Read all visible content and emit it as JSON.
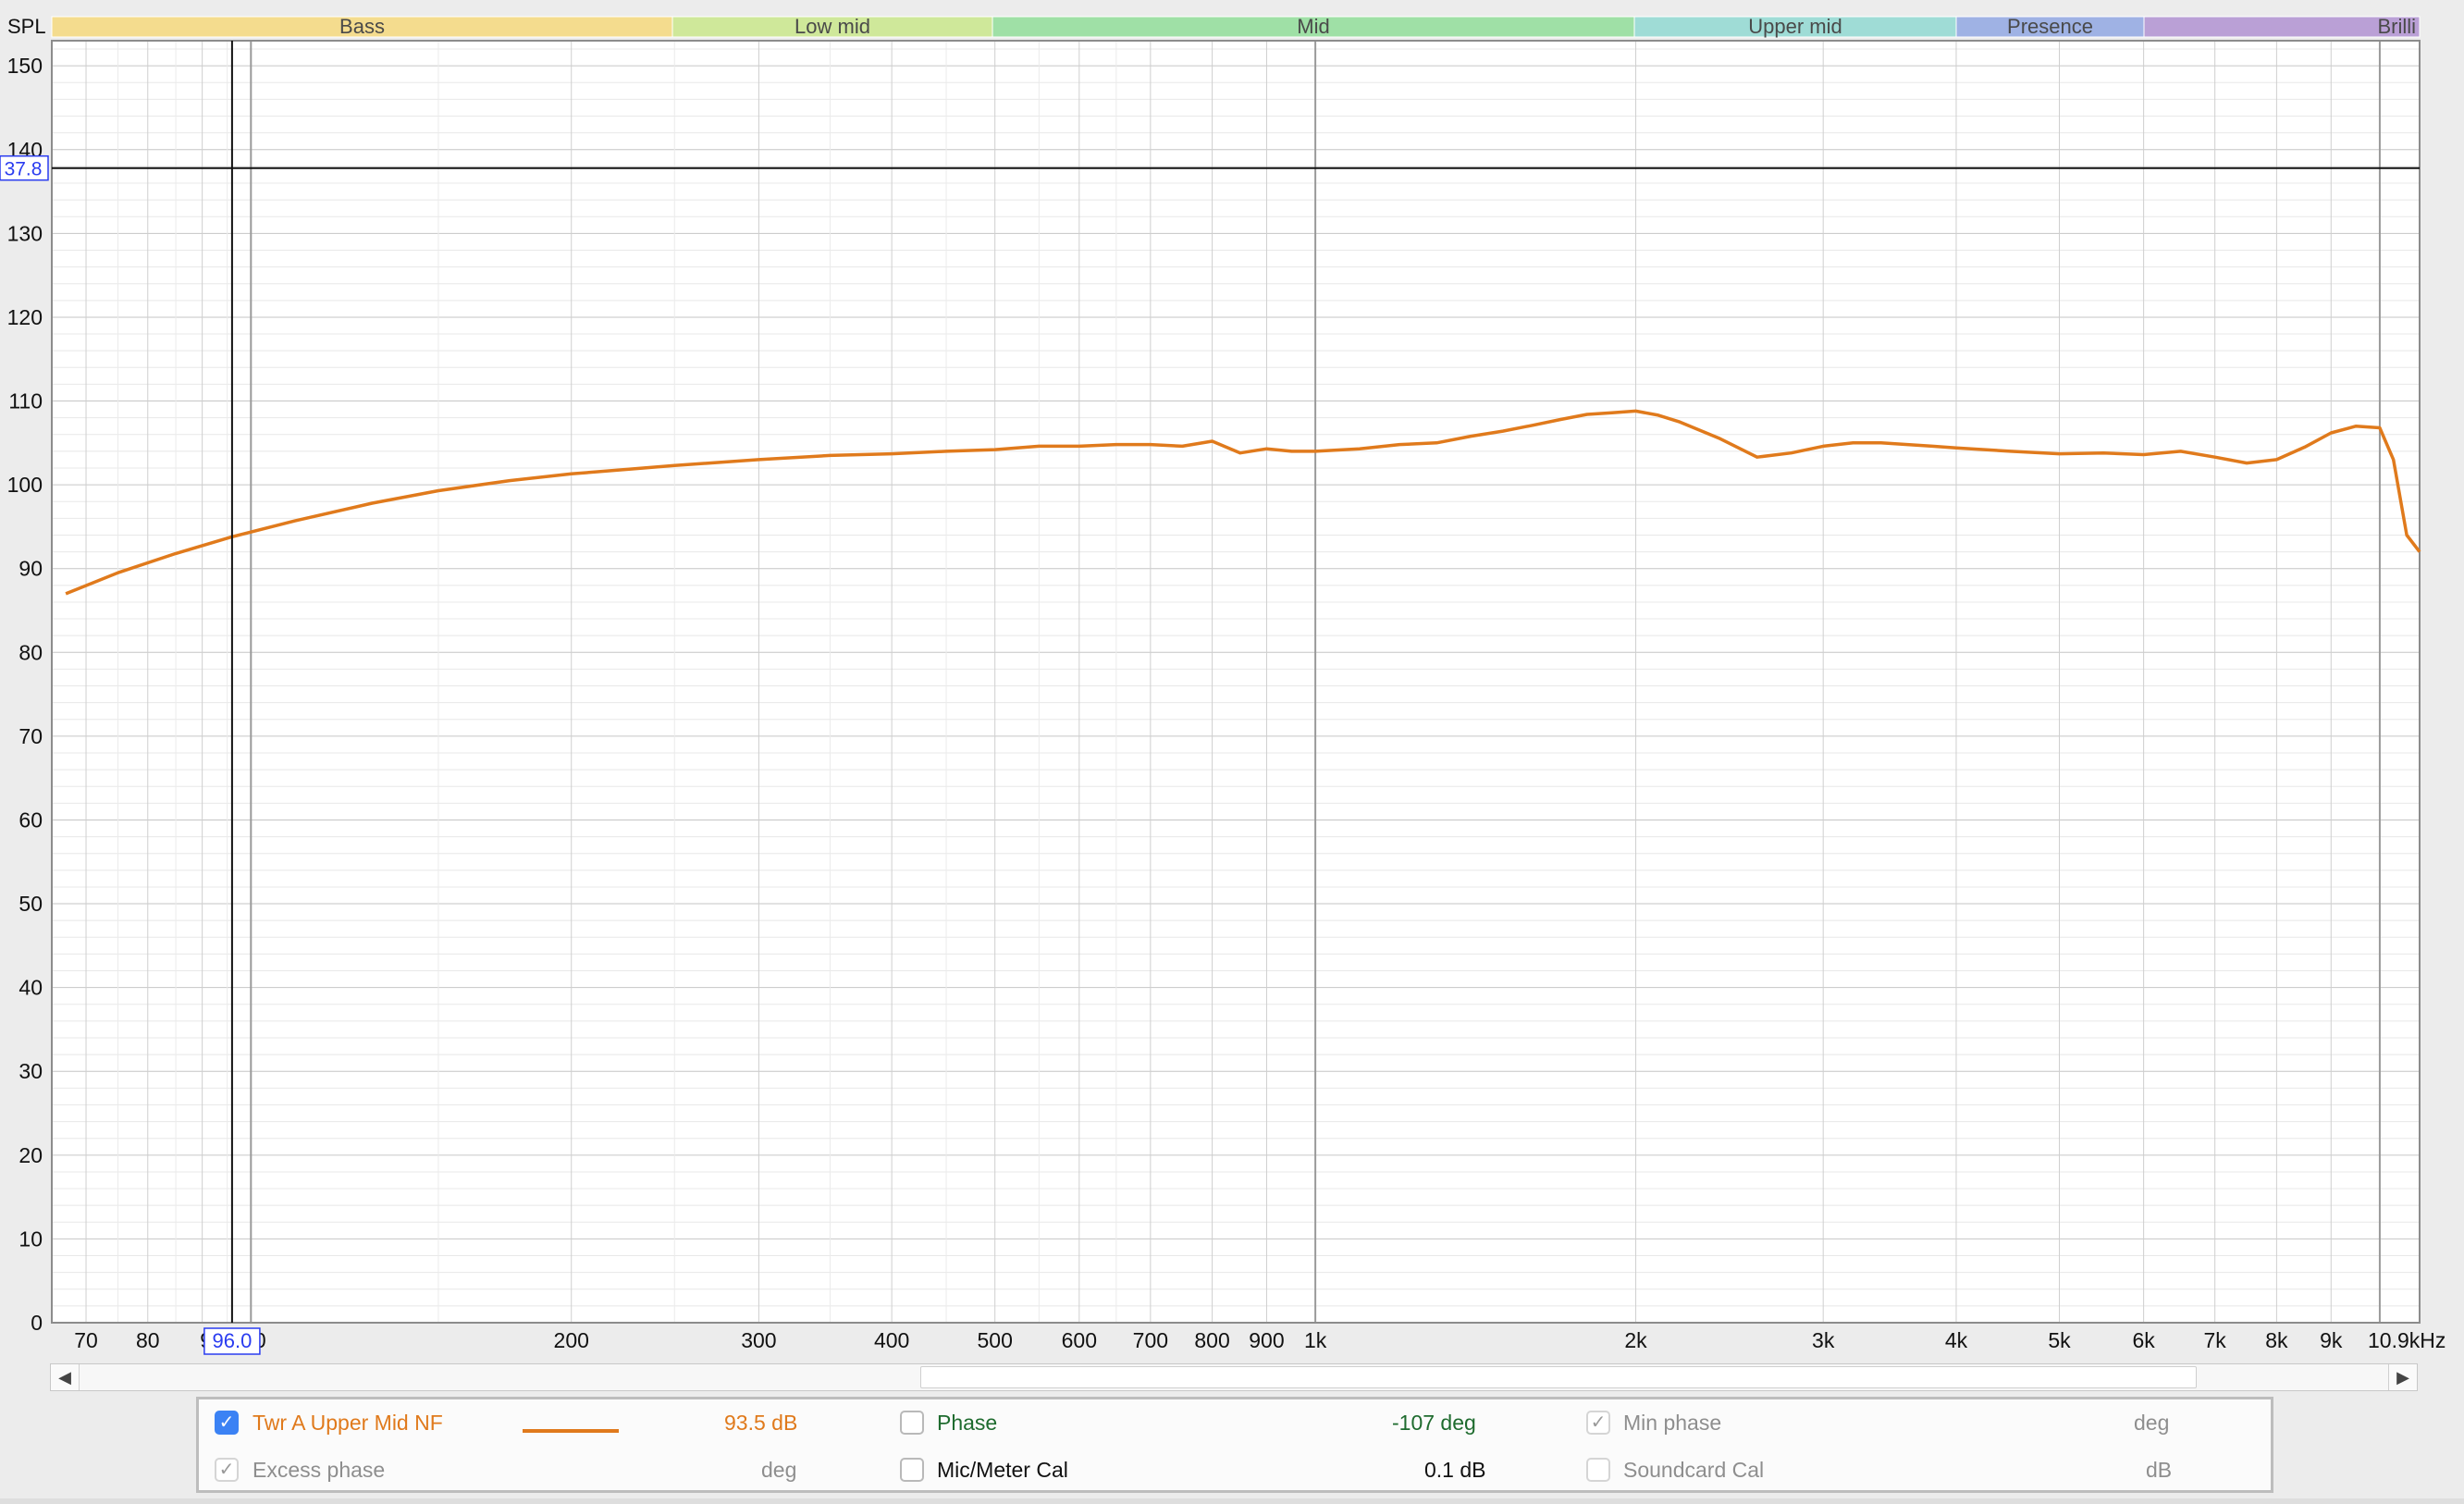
{
  "bands": [
    {
      "label": "Bass",
      "color": "#f4dc8e"
    },
    {
      "label": "Low mid",
      "color": "#cfe89a"
    },
    {
      "label": "Mid",
      "color": "#9fe0a6"
    },
    {
      "label": "Upper mid",
      "color": "#9fdcd6"
    },
    {
      "label": "Presence",
      "color": "#9fb2e4"
    },
    {
      "label": "Brilli",
      "color": "#baa0d6"
    }
  ],
  "y_axis_title": "SPL",
  "y_ticks": [
    "150",
    "140",
    "130",
    "120",
    "110",
    "100",
    "90",
    "80",
    "70",
    "60",
    "50",
    "40",
    "30",
    "20",
    "10",
    "0"
  ],
  "x_ticks": [
    "70",
    "80",
    "9",
    "0",
    "200",
    "300",
    "400",
    "500",
    "600",
    "700",
    "800",
    "900",
    "1k",
    "2k",
    "3k",
    "4k",
    "5k",
    "6k",
    "7k",
    "8k",
    "9k",
    "10.9kHz"
  ],
  "cursor": {
    "y_readout": "37.8",
    "x_readout": "96.0"
  },
  "chart_data": {
    "type": "line",
    "xscale": "log",
    "xlim": [
      65,
      10900
    ],
    "ylim": [
      0,
      153
    ],
    "grid": true,
    "ylabel": "SPL",
    "xlabel": "",
    "cursor_x": 96.0,
    "cursor_y": 137.8,
    "series": [
      {
        "name": "Twr A Upper Mid NF",
        "color": "#e07a1c",
        "x": [
          67,
          75,
          85,
          96,
          110,
          130,
          150,
          175,
          200,
          250,
          300,
          350,
          400,
          450,
          500,
          550,
          600,
          650,
          700,
          750,
          800,
          850,
          900,
          950,
          1000,
          1100,
          1200,
          1300,
          1400,
          1500,
          1600,
          1700,
          1800,
          1900,
          2000,
          2100,
          2200,
          2400,
          2600,
          2800,
          3000,
          3200,
          3400,
          3600,
          3800,
          4000,
          4500,
          5000,
          5500,
          6000,
          6500,
          7000,
          7500,
          8000,
          8500,
          9000,
          9500,
          10000,
          10300,
          10600,
          10900
        ],
        "y": [
          87,
          89.5,
          91.8,
          93.8,
          95.7,
          97.8,
          99.3,
          100.5,
          101.3,
          102.3,
          103.0,
          103.5,
          103.7,
          104.0,
          104.2,
          104.6,
          104.6,
          104.8,
          104.8,
          104.6,
          105.2,
          103.8,
          104.3,
          104.0,
          104.0,
          104.3,
          104.8,
          105.0,
          105.8,
          106.4,
          107.1,
          107.8,
          108.4,
          108.6,
          108.8,
          108.3,
          107.5,
          105.5,
          103.3,
          103.8,
          104.6,
          105.0,
          105.0,
          104.8,
          104.6,
          104.4,
          104.0,
          103.7,
          103.8,
          103.6,
          104.0,
          103.3,
          102.6,
          103.0,
          104.5,
          106.2,
          107.0,
          106.8,
          103.0,
          94.0,
          92.0
        ]
      }
    ]
  },
  "scrollbar": {
    "left_arrow": "◀",
    "right_arrow": "▶"
  },
  "legend": {
    "row1": {
      "trace_name": "Twr A Upper Mid NF",
      "trace_value": "93.5 dB",
      "phase_label": "Phase",
      "phase_value": "-107 deg",
      "min_phase_label": "Min phase",
      "min_phase_unit": "deg"
    },
    "row2": {
      "excess_phase_label": "Excess phase",
      "excess_phase_unit": "deg",
      "mic_cal_label": "Mic/Meter Cal",
      "mic_cal_value": "0.1 dB",
      "soundcard_cal_label": "Soundcard Cal",
      "soundcard_cal_unit": "dB"
    },
    "checkmark": "✓"
  }
}
